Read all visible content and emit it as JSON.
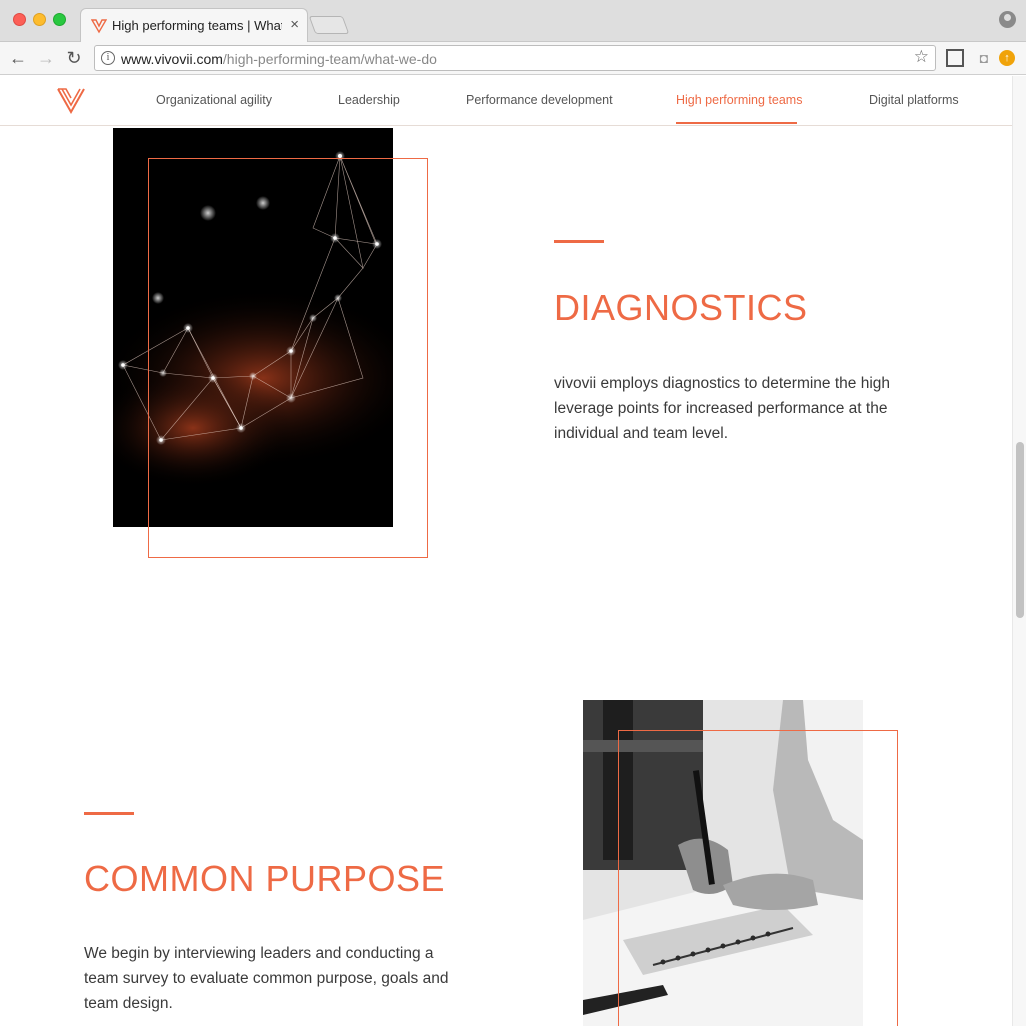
{
  "browser": {
    "tab_title": "High performing teams | What we do",
    "url_host": "www.vivovii.com",
    "url_path": "/high-performing-team/what-we-do"
  },
  "nav": {
    "items": [
      {
        "label": "Organizational agility"
      },
      {
        "label": "Leadership"
      },
      {
        "label": "Performance development"
      },
      {
        "label": "High performing teams",
        "active": true
      },
      {
        "label": "Digital platforms"
      }
    ]
  },
  "sections": [
    {
      "heading": "DIAGNOSTICS",
      "body": "vivovii employs diagnostics to determine the high leverage points for increased performance at the individual and team level."
    },
    {
      "heading": "COMMON PURPOSE",
      "body": "We begin by interviewing leaders and conducting a team survey to evaluate common purpose, goals and team design."
    }
  ],
  "colors": {
    "accent": "#ee6a45"
  }
}
